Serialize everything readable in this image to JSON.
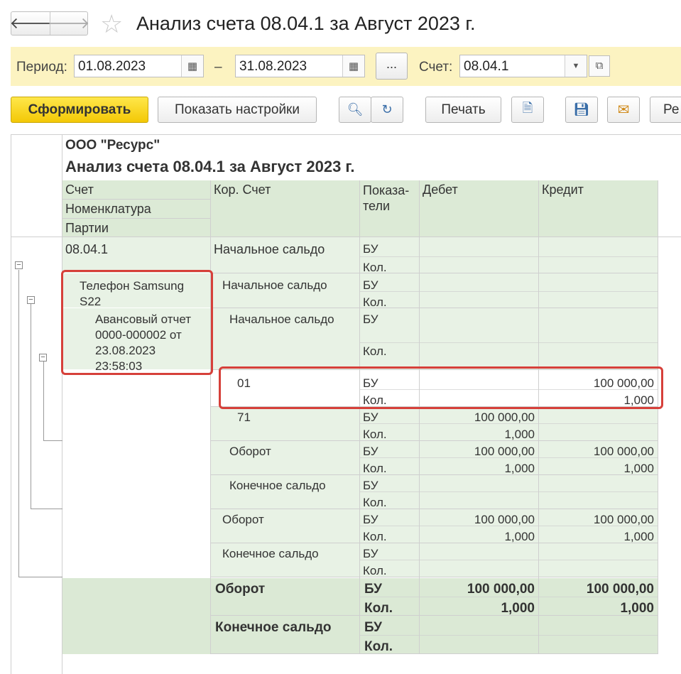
{
  "window": {
    "title": "Анализ счета 08.04.1 за Август 2023 г."
  },
  "nav": {
    "back_icon": "arrow-left-icon",
    "forward_icon": "arrow-right-icon",
    "favorite_icon": "star-icon"
  },
  "period": {
    "label": "Период:",
    "from": "01.08.2023",
    "dash": "–",
    "to": "31.08.2023",
    "more": "...",
    "account_label": "Счет:",
    "account_value": "08.04.1"
  },
  "toolbar": {
    "generate": "Сформировать",
    "settings": "Показать настройки",
    "print": "Печать",
    "partial_next": "Ре"
  },
  "report": {
    "org": "ООО \"Ресурс\"",
    "title": "Анализ счета 08.04.1 за Август 2023 г.",
    "headers": {
      "account": "Счет",
      "nomenclature": "Номенклатура",
      "batches": "Партии",
      "cor_account": "Кор. Счет",
      "indicators_1": "Показа-",
      "indicators_2": "тели",
      "debit": "Дебет",
      "credit": "Кредит"
    },
    "groups": {
      "account": "08.04.1",
      "item_1": "Телефон Samsung",
      "item_2": "S22",
      "batch_1": "Авансовый отчет",
      "batch_2": "0000-000002 от",
      "batch_3": "23.08.2023",
      "batch_4": "23:58:03"
    },
    "rows": [
      {
        "cor": "Начальное сальдо",
        "ind1": "БУ",
        "ind2": "Кол.",
        "d1": "",
        "d2": "",
        "c1": "",
        "c2": ""
      },
      {
        "cor": "Начальное сальдо",
        "ind1": "БУ",
        "ind2": "Кол.",
        "d1": "",
        "d2": "",
        "c1": "",
        "c2": ""
      },
      {
        "cor": "Начальное сальдо",
        "ind1": "БУ",
        "ind2": "Кол.",
        "d1": "",
        "d2": "",
        "c1": "",
        "c2": ""
      },
      {
        "cor": "01",
        "ind1": "БУ",
        "ind2": "Кол.",
        "d1": "",
        "d2": "",
        "c1": "100 000,00",
        "c2": "1,000"
      },
      {
        "cor": "71",
        "ind1": "БУ",
        "ind2": "Кол.",
        "d1": "100 000,00",
        "d2": "1,000",
        "c1": "",
        "c2": ""
      },
      {
        "cor": "Оборот",
        "ind1": "БУ",
        "ind2": "Кол.",
        "d1": "100 000,00",
        "d2": "1,000",
        "c1": "100 000,00",
        "c2": "1,000"
      },
      {
        "cor": "Конечное сальдо",
        "ind1": "БУ",
        "ind2": "Кол.",
        "d1": "",
        "d2": "",
        "c1": "",
        "c2": ""
      },
      {
        "cor": "Оборот",
        "ind1": "БУ",
        "ind2": "Кол.",
        "d1": "100 000,00",
        "d2": "1,000",
        "c1": "100 000,00",
        "c2": "1,000"
      },
      {
        "cor": "Конечное сальдо",
        "ind1": "БУ",
        "ind2": "Кол.",
        "d1": "",
        "d2": "",
        "c1": "",
        "c2": ""
      },
      {
        "cor": "Оборот",
        "ind1": "БУ",
        "ind2": "Кол.",
        "d1": "100 000,00",
        "d2": "1,000",
        "c1": "100 000,00",
        "c2": "1,000"
      },
      {
        "cor": "Конечное сальдо",
        "ind1": "БУ",
        "ind2": "Кол.",
        "d1": "",
        "d2": "",
        "c1": "",
        "c2": ""
      }
    ],
    "collapse_glyph": "−"
  },
  "colors": {
    "period_bar": "#fcf3c1",
    "primary_button": "#f3c806",
    "header_bg": "#dcead6",
    "group_bg": "#e8f2e5",
    "highlight": "#d6403a"
  }
}
